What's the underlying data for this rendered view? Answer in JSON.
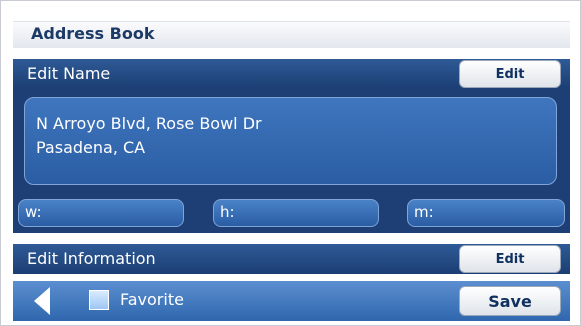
{
  "header": {
    "title": "Address Book"
  },
  "edit_name": {
    "label": "Edit Name",
    "button": "Edit"
  },
  "address": {
    "line1": "N Arroyo Blvd, Rose Bowl Dr",
    "line2": "Pasadena, CA"
  },
  "phones": [
    {
      "label": "w:"
    },
    {
      "label": "h:"
    },
    {
      "label": "m:"
    }
  ],
  "edit_info": {
    "label": "Edit Information",
    "button": "Edit"
  },
  "footer": {
    "favorite_label": "Favorite",
    "save_label": "Save"
  }
}
